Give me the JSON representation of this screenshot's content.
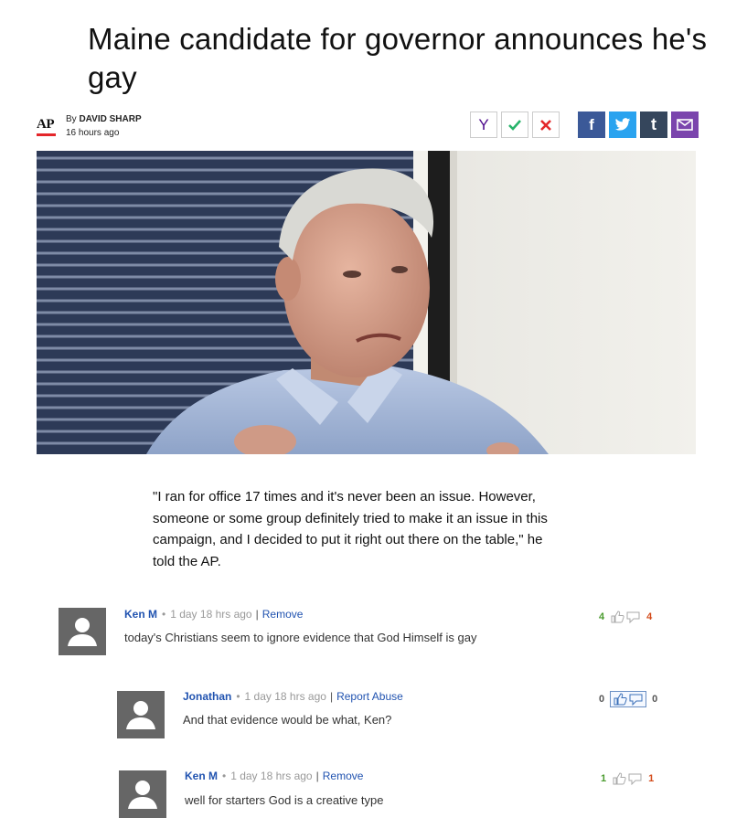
{
  "article": {
    "headline": "Maine candidate for governor announces he's gay",
    "source_logo": "AP",
    "by_prefix": "By",
    "author": "DAVID SHARP",
    "timestamp": "16 hours ago",
    "quote": "\"I ran for office 17 times and it's never been an issue. However, someone or some group definitely tried to make it an issue in this campaign, and I decided to put it right out there on the table,\" he told the AP."
  },
  "share": {
    "yahoo_label": "Y",
    "facebook_label": "f",
    "tumblr_label": "t",
    "icons": [
      "yahoo-icon",
      "check-icon",
      "cross-icon",
      "facebook-icon",
      "twitter-icon",
      "tumblr-icon",
      "mail-icon"
    ]
  },
  "comments": [
    {
      "name": "Ken M",
      "time": "1 day 18 hrs ago",
      "action": "Remove",
      "text": "today's Christians seem to ignore evidence that God Himself is gay",
      "up": "4",
      "down": "4"
    },
    {
      "name": "Jonathan",
      "time": "1 day 18 hrs ago",
      "action": "Report Abuse",
      "text": "And that evidence would be what, Ken?",
      "up": "0",
      "down": "0"
    },
    {
      "name": "Ken M",
      "time": "1 day 18 hrs ago",
      "action": "Remove",
      "text": "well for starters God is a creative type",
      "up": "1",
      "down": "1"
    }
  ],
  "colors": {
    "link": "#2153b0",
    "ap_red": "#e4262a",
    "facebook": "#3b5998",
    "twitter": "#2aa3ef",
    "tumblr": "#35465c",
    "mail": "#7b45ad",
    "upvote": "#4a9b2e",
    "downvote": "#d34b1a"
  }
}
